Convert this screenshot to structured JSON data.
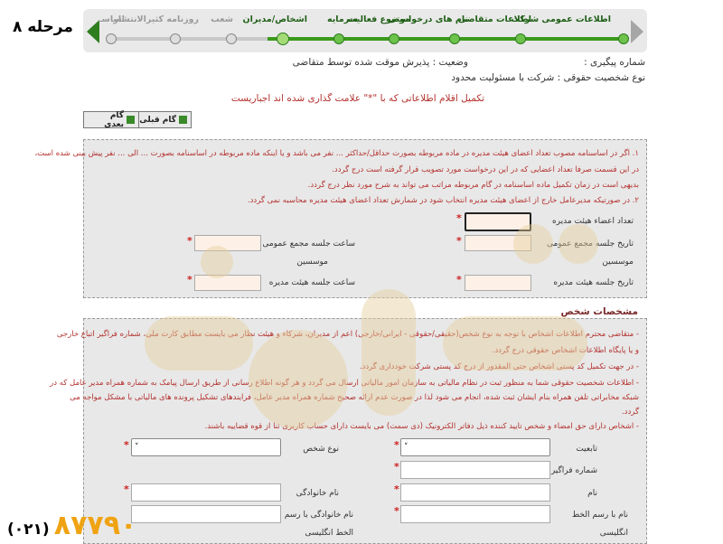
{
  "step_label": "مرحله ۸",
  "wizard": {
    "steps": [
      {
        "label": "اطلاعات عمومی شرکت",
        "state": "done"
      },
      {
        "label": "اطلاعات متقاضی",
        "state": "done"
      },
      {
        "label": "نام های درخواستی",
        "state": "done"
      },
      {
        "label": "موضوع فعالیت",
        "state": "done"
      },
      {
        "label": "سرمایه",
        "state": "done"
      },
      {
        "label": "اشخاص/مدیران",
        "state": "current"
      },
      {
        "label": "شعب",
        "state": "pending"
      },
      {
        "label": "روزنامه کثیرالانتشار",
        "state": "pending"
      },
      {
        "label": "اساسـ",
        "state": "pending"
      }
    ]
  },
  "info": {
    "tracking_label": "شماره پیگیری :",
    "status": "وضعیت : پذیرش موقت شده توسط متقاضی",
    "legal_type": "نوع شخصیت حقوقی : شرکت با مسئولیت محدود",
    "required_hint": "تکمیل اقلام اطلاعاتی که با \"*\" علامت گذاری شده اند اجباریست"
  },
  "nav": {
    "prev_label": "گام قبلی",
    "next_label": "گام بعدی"
  },
  "board": {
    "notes": [
      "۱. اگر در اساسنامه مصوب تعداد اعضای هیئت مدیره در ماده مربوطه بصورت حداقل/حداکثر ... نفر می باشد و یا اینکه ماده مربوطه در اساسنامه بصورت ... الی ... نفر پیش بینی شده است،",
      "در این قسمت صرفا تعداد اعضایی که در این درخواست مورد تصویب قرار گرفته است درج گردد.",
      "بدیهی است در زمان تکمیل ماده اساسنامه در گام مربوطه مراتب می تواند به شرح مورد نظر درج گردد.",
      "۲. در صورتیکه مدیرعامل خارج از اعضای هیئت مدیره انتخاب شود در شمارش تعداد اعضای هیئت مدیره محاسبه نمی گردد."
    ],
    "fields": {
      "member_count": "تعداد اعضاء هیئت مدیره",
      "assembly_date": "تاریخ جلسه مجمع عمومی",
      "founders": "موسسین",
      "assembly_time": "ساعت جلسه مجمع عمومی",
      "board_date": "تاریخ جلسه هیئت مدیره",
      "board_time": "ساعت جلسه هیئت مدیره"
    }
  },
  "persons": {
    "title": "مشخصات شخص",
    "notes": [
      "- متقاضی محترم اطلاعات اشخاص با توجه به نوع شخص(حقیقی/حقوقی - ایرانی/خارجی) اعم از مدیران، شرکاء و هیئت نظار می بایست مطابق کارت ملی، شماره فراگیر اتباع خارجی",
      "و یا پایگاه اطلاعات اشخاص حقوقی درج گردد.",
      "- در جهت تکمیل کد پستی اشخاص حتی المقدور از درج کد پستی شرکت خودداری گردد.",
      "- اطلاعات شخصیت حقوقی شما به منظور ثبت در نظام مالیاتی به سازمان امور مالیاتی ارسال می گردد و هر گونه اطلاع رسانی از طریق ارسال پیامک به شماره همراه مدیر عامل که در",
      "شبکه مخابراتی تلفن همراه بنام ایشان ثبت شده، انجام می شود لذا در صورت عدم ارائه صحیح شماره همراه مدیر عامل، فرایندهای تشکیل پرونده های مالیاتی با مشکل مواجه می",
      "گردد.",
      "- اشخاص دارای حق امضاء و شخص تایید کننده ذیل دفاتر الکترونیک (دی سمت) می بایست دارای حساب کاربری ثنا از قوه قضاییه باشند."
    ],
    "fields": {
      "nationality": "تابعیت",
      "person_type": "نوع شخص",
      "universal_id": "شماره فراگیر",
      "first_name": "نام",
      "last_name": "نام خانوادگی",
      "first_name_en": "نام با رسم الخط",
      "first_name_en_2": "انگلیسی",
      "last_name_en": "نام خانوادگی با رسم",
      "last_name_en_2": "الخط انگلیسی"
    }
  },
  "watermark_text": "ثبت ونک",
  "phone": {
    "code": "(۰۲۱)",
    "number": "۸۷۷۹۰"
  },
  "colors": {
    "accent_green": "#3a9a1a",
    "note_red": "#b3322f",
    "phone_orange": "#f0a312"
  }
}
